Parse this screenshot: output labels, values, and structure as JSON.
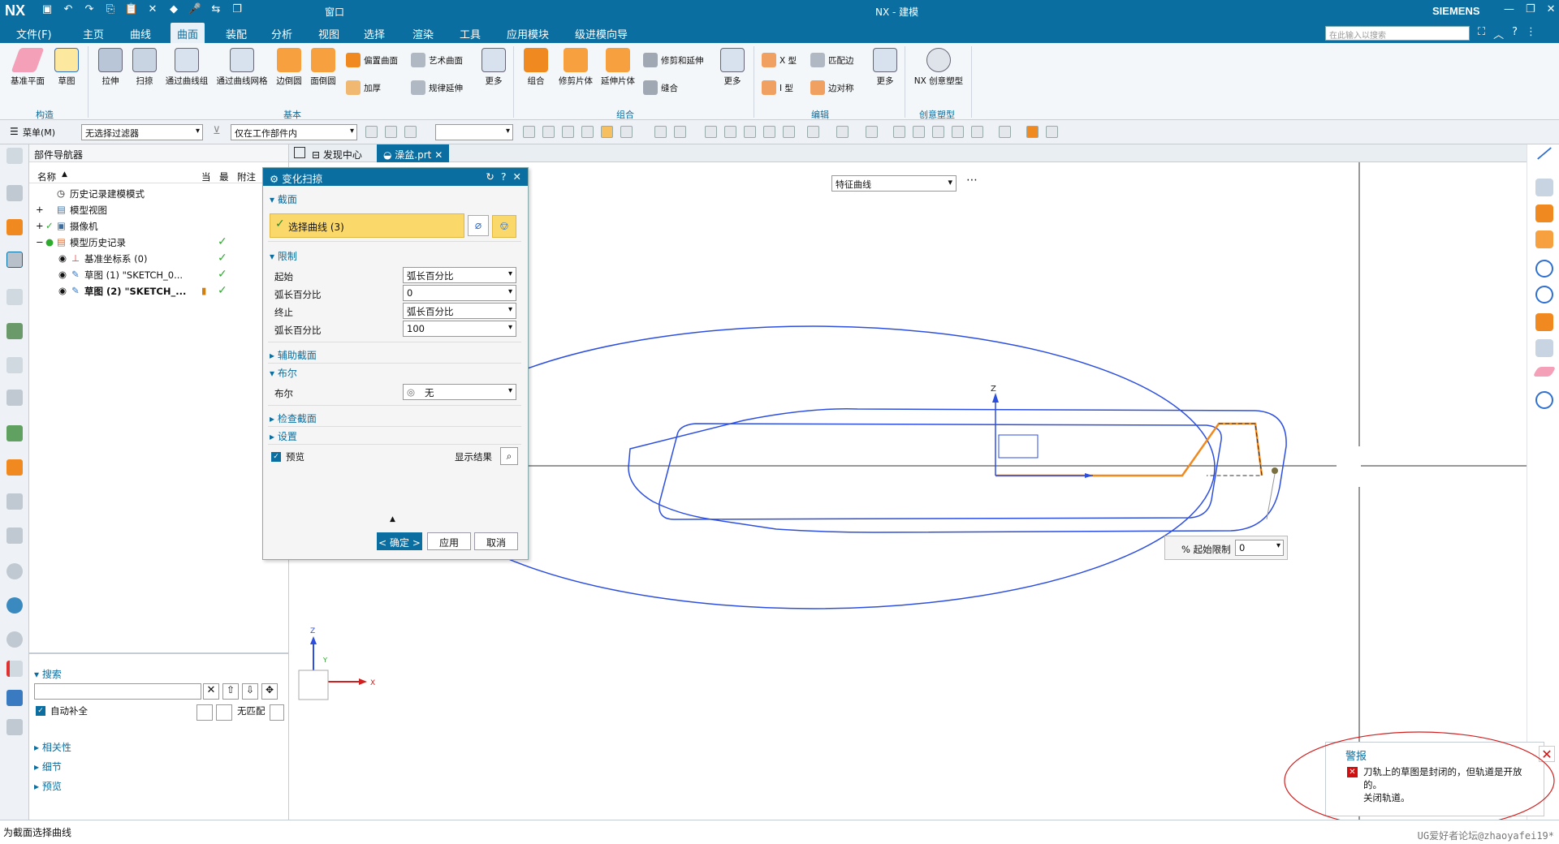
{
  "titlebar": {
    "logo": "NX",
    "window_menu": "窗口",
    "title": "NX - 建模",
    "brand": "SIEMENS"
  },
  "menu": {
    "items": [
      "文件(F)",
      "主页",
      "曲线",
      "曲面",
      "装配",
      "分析",
      "视图",
      "选择",
      "渲染",
      "工具",
      "应用模块",
      "级进模向导"
    ],
    "active": "曲面",
    "search_placeholder": "在此输入以搜索"
  },
  "ribbon": {
    "buttons": [
      {
        "label": "基准平面",
        "icon": "datum-plane-icon"
      },
      {
        "label": "草图",
        "icon": "sketch-icon"
      },
      {
        "label": "拉伸",
        "icon": "extrude-icon"
      },
      {
        "label": "扫掠",
        "icon": "sweep-icon"
      },
      {
        "label": "通过曲线组",
        "icon": "through-curves-icon"
      },
      {
        "label": "通过曲线网格",
        "icon": "curve-mesh-icon"
      },
      {
        "label": "边倒圆",
        "icon": "edge-blend-icon"
      },
      {
        "label": "面倒圆",
        "icon": "face-blend-icon"
      },
      {
        "label": "更多",
        "icon": "more-icon"
      },
      {
        "label": "组合",
        "icon": "combine-icon"
      },
      {
        "label": "修剪片体",
        "icon": "trim-sheet-icon"
      },
      {
        "label": "延伸片体",
        "icon": "extend-sheet-icon"
      },
      {
        "label": "更多",
        "icon": "more-icon"
      },
      {
        "label": "更多",
        "icon": "more-icon"
      },
      {
        "label": "NX 创意塑型",
        "icon": "realize-shape-icon"
      }
    ],
    "small_buttons": [
      {
        "label": "偏置曲面",
        "icon": "offset-surface-icon"
      },
      {
        "label": "艺术曲面",
        "icon": "studio-surface-icon"
      },
      {
        "label": "加厚",
        "icon": "thicken-icon"
      },
      {
        "label": "规律延伸",
        "icon": "law-extension-icon"
      },
      {
        "label": "修剪和延伸",
        "icon": "trim-extend-icon"
      },
      {
        "label": "缝合",
        "icon": "sew-icon"
      },
      {
        "label": "X 型",
        "icon": "x-form-icon"
      },
      {
        "label": "匹配边",
        "icon": "match-edge-icon"
      },
      {
        "label": "I 型",
        "icon": "i-form-icon"
      },
      {
        "label": "边对称",
        "icon": "edge-symmetry-icon"
      }
    ],
    "groups": [
      "构造",
      "基本",
      "组合",
      "编辑",
      "创意塑型"
    ]
  },
  "toolbar2": {
    "menu_label": "菜单(M)",
    "filter": "无选择过滤器",
    "scope": "仅在工作部件内",
    "blank": ""
  },
  "navigator": {
    "title": "部件导航器",
    "columns": [
      "名称",
      "当",
      "最",
      "附注"
    ],
    "rows": [
      {
        "label": "历史记录建模模式",
        "indent": 0,
        "check": false
      },
      {
        "label": "模型视图",
        "indent": 0,
        "check": false
      },
      {
        "label": "摄像机",
        "indent": 0,
        "check": true
      },
      {
        "label": "模型历史记录",
        "indent": 0,
        "check": true
      },
      {
        "label": "基准坐标系 (0)",
        "indent": 1,
        "check": true
      },
      {
        "label": "草图 (1) \"SKETCH_0...",
        "indent": 1,
        "check": true
      },
      {
        "label": "草图 (2) \"SKETCH_...",
        "indent": 1,
        "check": true
      }
    ],
    "search_label": "搜索",
    "auto_complete": "自动补全",
    "no_match": "无匹配",
    "sections": [
      "相关性",
      "细节",
      "预览"
    ]
  },
  "tabs": [
    {
      "label": "发现中心",
      "active": false
    },
    {
      "label": "澡盆.prt",
      "active": true
    }
  ],
  "viewport": {
    "curve_filter": "特征曲线",
    "limit_label": "% 起始限制",
    "limit_value": "0",
    "axis_z": "Z",
    "axis_x": "X",
    "axis_y": "Y"
  },
  "dialog": {
    "title": "变化扫掠",
    "section_label": "截面",
    "select_curve": "选择曲线 (3)",
    "limits_label": "限制",
    "start_label": "起始",
    "start_value": "弧长百分比",
    "pct1_label": "弧长百分比",
    "pct1_value": "0",
    "end_label": "终止",
    "end_value": "弧长百分比",
    "pct2_label": "弧长百分比",
    "pct2_value": "100",
    "aux_section": "辅助截面",
    "boolean_section": "布尔",
    "boolean_label": "布尔",
    "boolean_value": "无",
    "check_section": "检查截面",
    "settings_section": "设置",
    "preview": "预览",
    "show_result": "显示结果",
    "ok": "< 确定 >",
    "apply": "应用",
    "cancel": "取消"
  },
  "alert": {
    "title": "警报",
    "message": "刀轨上的草图是封闭的，但轨道是开放的。",
    "sub": "关闭轨道。"
  },
  "status": {
    "message": "为截面选择曲线",
    "watermark": "UG爱好者论坛@zhaoyafei19*"
  },
  "colors": {
    "brand_blue": "#0a6ea0",
    "curve_blue": "#2d4fe0",
    "orange": "#f08a20",
    "highlight_yellow": "#fbd86a",
    "alert_red": "#d01010"
  }
}
